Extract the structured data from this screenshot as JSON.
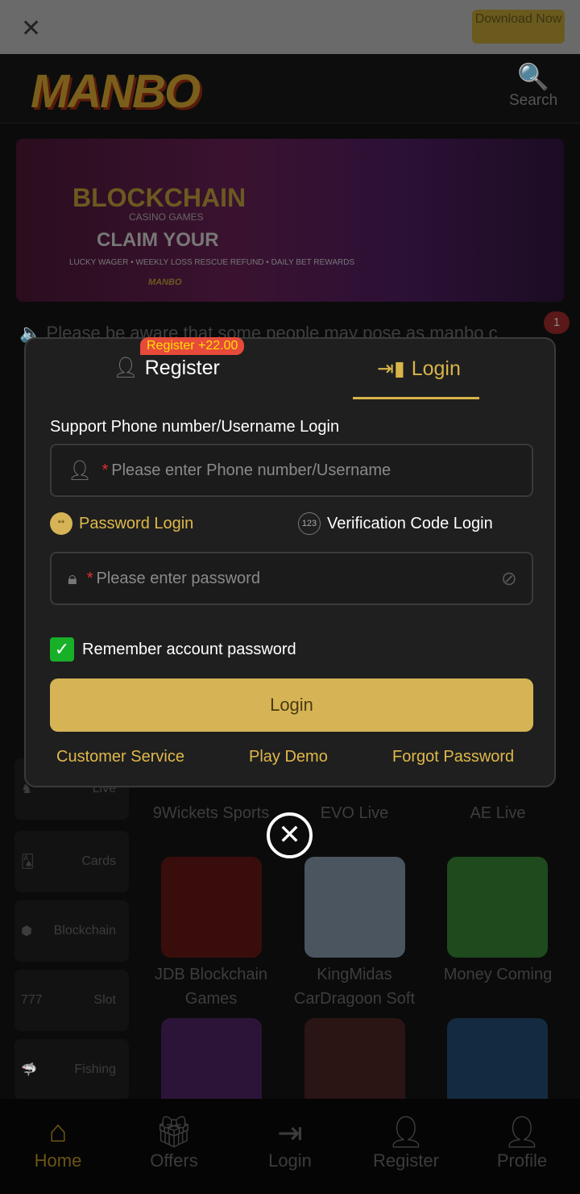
{
  "topbar": {
    "close_icon": "close-icon",
    "download_label": "Download Now"
  },
  "header": {
    "logo": "MANBO",
    "search_label": "Search"
  },
  "banner": {
    "title": "BLOCKCHAIN",
    "subtitle": "CASINO GAMES",
    "claim": "CLAIM YOUR",
    "perks": "LUCKY WAGER • WEEKLY LOSS RESCUE REFUND • DAILY BET REWARDS",
    "brand": "MANBO"
  },
  "notice": {
    "text": "Please be aware that some people may pose as manbo c",
    "count": "1"
  },
  "sidebar": [
    {
      "label": "Live"
    },
    {
      "label": "Cards"
    },
    {
      "label": "Blockchain"
    },
    {
      "label": "Slot"
    },
    {
      "label": "Fishing"
    }
  ],
  "games": [
    {
      "name": "9Wickets Sports"
    },
    {
      "name": "EVO Live"
    },
    {
      "name": "AE Live"
    },
    {
      "name": "JDB Blockchain Games"
    },
    {
      "name": "KingMidas CarDragoon Soft"
    },
    {
      "name": "Money Coming"
    }
  ],
  "bottom_nav": [
    {
      "label": "Home"
    },
    {
      "label": "Offers"
    },
    {
      "label": "Login"
    },
    {
      "label": "Register"
    },
    {
      "label": "Profile"
    }
  ],
  "modal": {
    "tab_register": "Register",
    "register_badge": "Register +22.00",
    "tab_login": "Login",
    "support_label": "Support Phone number/Username Login",
    "username_placeholder": "Please enter Phone number/Username",
    "password_login": "Password Login",
    "password_login_icon": "**",
    "code_login": "Verification Code Login",
    "code_login_icon": "123",
    "password_placeholder": "Please enter password",
    "remember": "Remember account password",
    "remember_checked": true,
    "login_button": "Login",
    "customer_service": "Customer Service",
    "play_demo": "Play Demo",
    "forgot_password": "Forgot Password",
    "accent": "#d6b456"
  }
}
